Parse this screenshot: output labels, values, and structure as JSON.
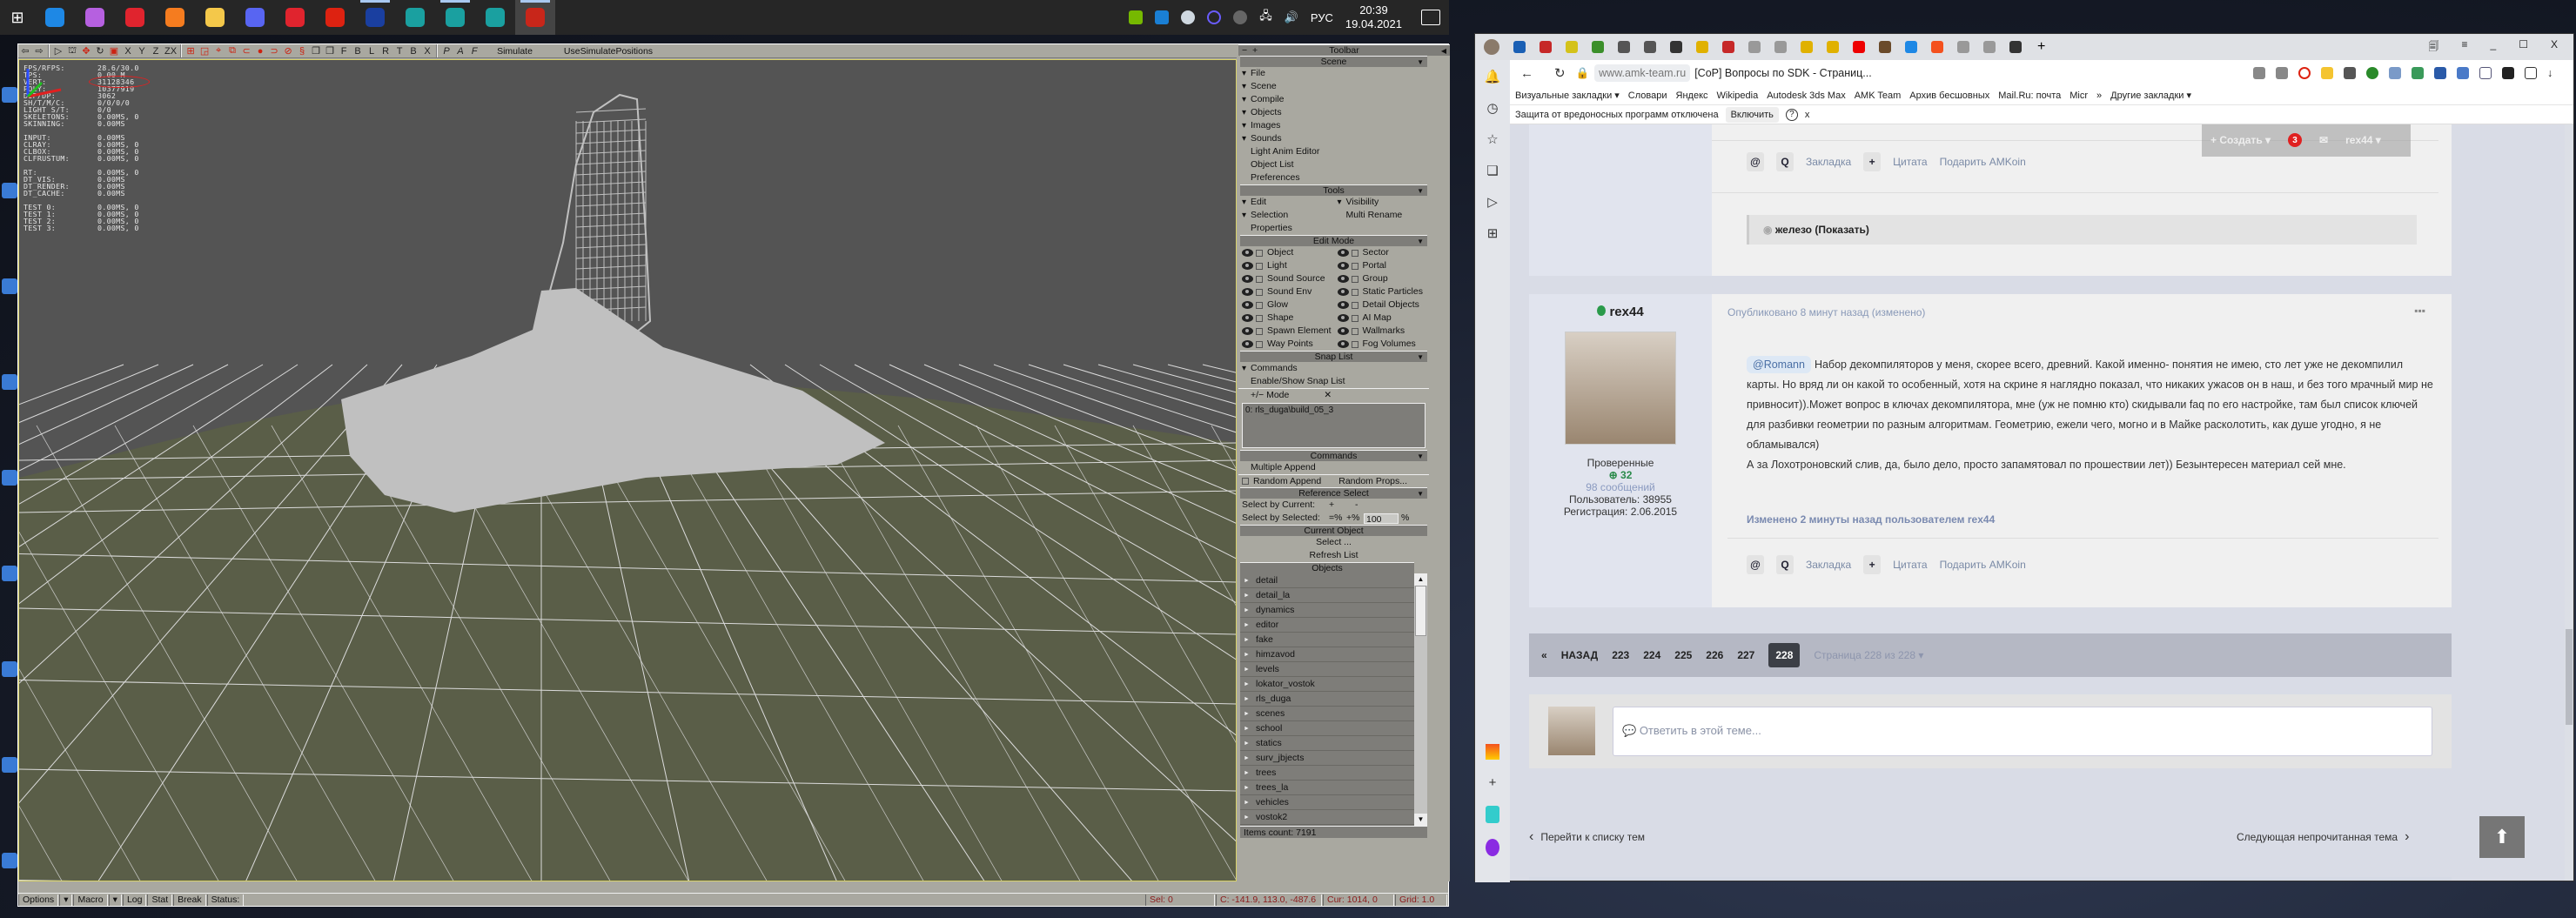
{
  "taskbar": {
    "apps": [
      {
        "name": "edge",
        "color": "#1e88e5",
        "open": false
      },
      {
        "name": "crystal-app",
        "color": "#b660e0",
        "open": false
      },
      {
        "name": "opera",
        "color": "#e0242e",
        "open": false
      },
      {
        "name": "firefox",
        "color": "#f57c1f",
        "open": false
      },
      {
        "name": "file-explorer",
        "color": "#f4c84a",
        "open": false
      },
      {
        "name": "discord",
        "color": "#5865f2",
        "open": false
      },
      {
        "name": "yandex-browser",
        "color": "#e0242e",
        "open": false
      },
      {
        "name": "x-app",
        "color": "#d21",
        "open": false
      },
      {
        "name": "ap2",
        "color": "#1a3fa0",
        "open": true
      },
      {
        "name": "maya-1",
        "color": "#1aa0a0",
        "open": false
      },
      {
        "name": "3ds-max",
        "color": "#1aa0a0",
        "open": true
      },
      {
        "name": "maya-2",
        "color": "#1aa0a0",
        "open": false
      },
      {
        "name": "level-editor",
        "color": "#c8261a",
        "open": true,
        "active": true
      }
    ],
    "tray": {
      "lang": "РУС",
      "time": "20:39",
      "date": "19.04.2021"
    }
  },
  "editor": {
    "toolbar": {
      "axis_labels": [
        "X",
        "Y",
        "Z",
        "ZX"
      ],
      "view_labels": [
        "F",
        "B",
        "L",
        "R",
        "T",
        "B",
        "X"
      ],
      "extra_labels": [
        "P",
        "A",
        "F"
      ],
      "simulate": "Simulate",
      "use_simulate_positions": "UseSimulatePositions"
    },
    "stats": [
      {
        "k": "FPS/RFPS:",
        "v": "28.6/30.0"
      },
      {
        "k": "TPS:",
        "v": "0.00 M"
      },
      {
        "k": "VERT:",
        "v": "31128346"
      },
      {
        "k": "POLY:",
        "v": "10377919"
      },
      {
        "k": "DIP/DP:",
        "v": "3062"
      },
      {
        "k": "SH/T/M/C:",
        "v": "0/0/0/0"
      },
      {
        "k": "LIGHT S/T:",
        "v": "0/0"
      },
      {
        "k": "SKELETONS:",
        "v": "0.00MS,  0"
      },
      {
        "k": "SKINNING:",
        "v": "0.00MS"
      },
      {
        "k": "",
        "v": ""
      },
      {
        "k": "INPUT:",
        "v": "0.00MS"
      },
      {
        "k": "CLRAY:",
        "v": "0.00MS,  0"
      },
      {
        "k": "CLBOX:",
        "v": "0.00MS,  0"
      },
      {
        "k": "CLFRUSTUM:",
        "v": "0.00MS,  0"
      },
      {
        "k": "",
        "v": ""
      },
      {
        "k": " RT:",
        "v": "0.00MS,  0"
      },
      {
        "k": " DT_VIS:",
        "v": "0.00MS"
      },
      {
        "k": " DT_RENDER:",
        "v": "0.00MS"
      },
      {
        "k": " DT_CACHE:",
        "v": "0.00MS"
      },
      {
        "k": "",
        "v": ""
      },
      {
        "k": "TEST 0:",
        "v": "0.00MS,  0"
      },
      {
        "k": "TEST 1:",
        "v": "0.00MS,  0"
      },
      {
        "k": "TEST 2:",
        "v": "0.00MS,  0"
      },
      {
        "k": "TEST 3:",
        "v": "0.00MS,  0"
      }
    ],
    "panel": {
      "toolbar_title": "Toolbar",
      "toolbar_minus": "−",
      "toolbar_plus": "+",
      "scene": {
        "title": "Scene",
        "items": [
          {
            "label": "File",
            "expand": true
          },
          {
            "label": "Scene",
            "expand": true
          },
          {
            "label": "Compile",
            "expand": true
          },
          {
            "label": "Objects",
            "expand": true
          },
          {
            "label": "Images",
            "expand": true
          },
          {
            "label": "Sounds",
            "expand": true
          },
          {
            "label": "Light Anim Editor",
            "expand": false
          },
          {
            "label": "Object List",
            "expand": false
          },
          {
            "label": "Preferences",
            "expand": false
          }
        ]
      },
      "tools": {
        "title": "Tools",
        "left": [
          {
            "label": "Edit",
            "expand": true
          },
          {
            "label": "Selection",
            "expand": true
          },
          {
            "label": "Properties",
            "expand": false
          }
        ],
        "right": [
          {
            "label": "Visibility",
            "expand": true
          },
          {
            "label": "Multi Rename",
            "expand": false
          }
        ]
      },
      "edit_mode": {
        "title": "Edit Mode",
        "left": [
          "Object",
          "Light",
          "Sound Source",
          "Sound Env",
          "Glow",
          "Shape",
          "Spawn Element",
          "Way Points"
        ],
        "right": [
          "Sector",
          "Portal",
          "Group",
          "Static Particles",
          "Detail Objects",
          "AI Map",
          "Wallmarks",
          "Fog Volumes"
        ]
      },
      "snap_list": {
        "title": "Snap List",
        "commands": "Commands",
        "enable": "Enable/Show Snap List",
        "mode": "+/− Mode",
        "clear": "✕",
        "entries": [
          "0: rls_duga\\build_05_3"
        ]
      },
      "commands": {
        "title": "Commands",
        "multiple_append": "Multiple Append",
        "random_append": "Random Append",
        "random_props": "Random Props..."
      },
      "reference_select": {
        "title": "Reference Select",
        "by_current": "Select by Current:",
        "plus": "+",
        "minus": "-",
        "by_selected": "Select by Selected:",
        "eq_pct": "=%",
        "plus_pct": "+%",
        "value": "100",
        "pct": "%"
      },
      "current_object": {
        "title": "Current Object",
        "select": "Select ...",
        "refresh": "Refresh List"
      },
      "objects": {
        "title": "Objects",
        "items": [
          "detail",
          "detail_la",
          "dynamics",
          "editor",
          "fake",
          "himzavod",
          "levels",
          "lokator_vostok",
          "rls_duga",
          "scenes",
          "school",
          "statics",
          "surv_jbjects",
          "trees",
          "trees_la",
          "vehicles",
          "vostok2"
        ],
        "count": "Items count: 7191"
      }
    },
    "status": {
      "options": "Options",
      "macro": "Macro",
      "log": "Log",
      "stat": "Stat",
      "break": "Break",
      "status": "Status:",
      "sel": "Sel: 0",
      "coords": "C: -141.9, 113.0, -487.6",
      "cursor": "Cur: 1014, 0",
      "grid": "Grid: 1.0"
    },
    "colors": {
      "viewport_bg": "#545454",
      "ground": "#5a5e48",
      "wire": "#dcdcdc",
      "mesh": "#c0c0c0"
    }
  },
  "browser": {
    "tab_icons": [
      "#1a5fb4",
      "#c62828",
      "#d4c21a",
      "#3b8f2a",
      "#555",
      "#555",
      "#333",
      "#e0b100",
      "#c62828",
      "#999",
      "#999",
      "#e0b100",
      "#e0b100",
      "#e00",
      "#6a4a2a",
      "#1e88e5",
      "#f4511e",
      "#999",
      "#999",
      "#333"
    ],
    "new_tab": "+",
    "address": {
      "domain": "www.amk-team.ru",
      "title": "[CoP] Вопросы по SDK - Страниц..."
    },
    "bookmarks": [
      "Визуальные закладки ▾",
      "Словари",
      "Яндекс",
      "Wikipedia",
      "Autodesk 3ds Max",
      "AMK Team",
      "Архив бесшовных",
      "Mail.Ru: почта",
      "Micr",
      "»",
      "Другие закладки ▾"
    ],
    "warning": {
      "text": "Защита от вредоносных программ отключена",
      "button": "Включить",
      "help": "?",
      "close": "x"
    },
    "overlay": {
      "create": "+ Создать ▾",
      "notif_count": "3",
      "user": "rex44 ▾"
    },
    "post_actions": {
      "at": "@",
      "quote_q": "Q",
      "bookmark": "Закладка",
      "plus": "+",
      "quote": "Цитата",
      "gift": "Подарить AMKoin"
    },
    "spoiler": "железо (Показать)",
    "post": {
      "author": "rex44",
      "group": "Проверенные",
      "rep": "32",
      "messages": "98 сообщений",
      "user_id": "Пользователь: 38955",
      "registered": "Регистрация: 2.06.2015",
      "published": "Опубликовано 8 минут назад (изменено)",
      "mention": "@Romann",
      "text": "Набор декомпиляторов у меня, скорее всего, древний. Какой именно- понятия не имею, сто лет уже не декомпилил карты. Но вряд ли он какой то особенный, хотя на скрине я наглядно показал, что никаких ужасов он в наш, и без того мрачный мир не привносит)).Может вопрос в ключах декомпилятора, мне (уж не помню кто) скидывали faq по его настройке, там был список ключей для разбивки геометрии по разным алгоритмам. Геометрию, ежели чего, могно и в Майке расколотить, как душе угодно, я не обламывался)",
      "text2": "А за Лохотроновский слив, да, было дело, просто запамятовал по прошествии лет)) Безынтересен материал сей мне.",
      "edited": "Изменено 2 минуты назад пользователем rex44"
    },
    "pager": {
      "first": "«",
      "prev": "НАЗАД",
      "pages": [
        "223",
        "224",
        "225",
        "226",
        "227"
      ],
      "current": "228",
      "info": "Страница 228 из 228 ▾"
    },
    "reply_placeholder": "Ответить в этой теме...",
    "back_to_list": "Перейти к списку тем",
    "next_unread": "Следующая непрочитанная тема",
    "window_controls": {
      "min": "_",
      "max": "☐",
      "close": "X"
    }
  }
}
